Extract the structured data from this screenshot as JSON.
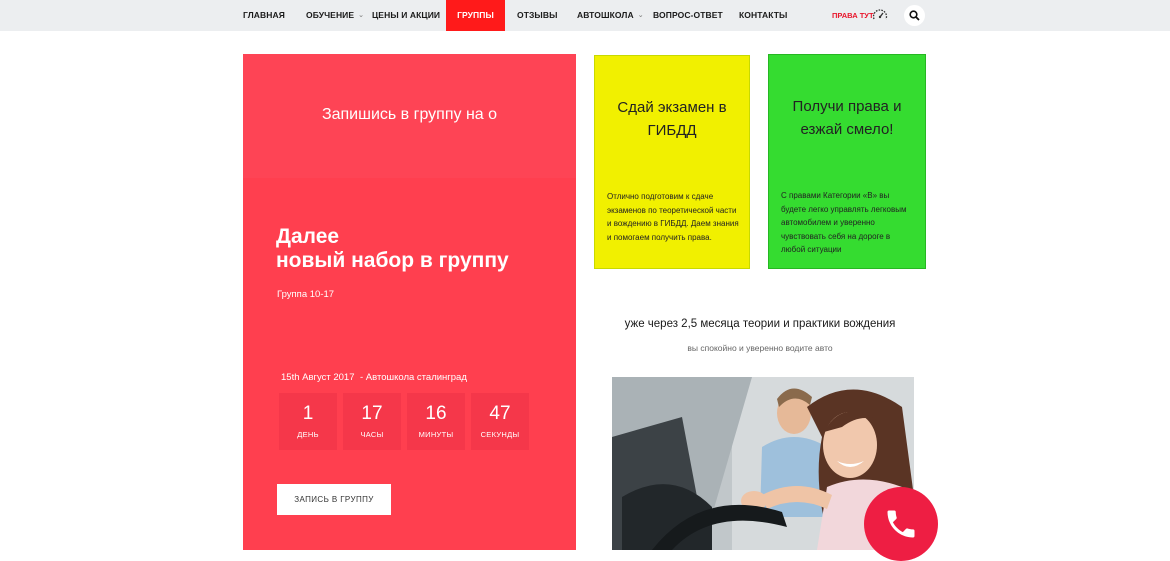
{
  "nav": {
    "items": [
      {
        "label": "ГЛАВНАЯ",
        "dropdown": false,
        "active": false
      },
      {
        "label": "ОБУЧЕНИЕ",
        "dropdown": true,
        "active": false
      },
      {
        "label": "ЦЕНЫ И АКЦИИ",
        "dropdown": false,
        "active": false
      },
      {
        "label": "ГРУППЫ",
        "dropdown": false,
        "active": true
      },
      {
        "label": "ОТЗЫВЫ",
        "dropdown": false,
        "active": false
      },
      {
        "label": "АВТОШКОЛА",
        "dropdown": true,
        "active": false
      },
      {
        "label": "ВОПРОС-ОТВЕТ",
        "dropdown": false,
        "active": false
      },
      {
        "label": "КОНТАКТЫ",
        "dropdown": false,
        "active": false
      }
    ],
    "rights_link": "ПРАВА ТУТ",
    "gauge_icon": "speedometer-icon",
    "search_icon": "search-icon"
  },
  "hero": {
    "title": "Запишись в группу на о",
    "heading_line1": "Далее",
    "heading_line2": "новый набор в группу",
    "group": "Группа 10-17",
    "date": "15th Август 2017",
    "place": "- Автошкола сталинград",
    "countdown": [
      {
        "value": "1",
        "label": "ДЕНЬ"
      },
      {
        "value": "17",
        "label": "ЧАСЫ"
      },
      {
        "value": "16",
        "label": "МИНУТЫ"
      },
      {
        "value": "47",
        "label": "СЕКУНДЫ"
      }
    ],
    "button_label": "ЗАПИСЬ В ГРУППУ"
  },
  "cards": [
    {
      "title_line1": "Сдай экзамен в",
      "title_line2": "ГИБДД",
      "text": "Отлично подготовим к сдаче экзаменов по теоретической части и вождению в ГИБДД. Даем знания и помогаем получить права.",
      "color": "#f1f000"
    },
    {
      "title_line1": "Получи права и",
      "title_line2": "езжай смело!",
      "text": "С правами Категории «В» вы будете легко управлять легковым автомобилем и уверенно чувствовать себя на дороге в любой ситуации",
      "color": "#35dc30"
    }
  ],
  "promo": {
    "main": "уже через 2,5 месяца теории и практики вождения",
    "sub": "вы спокойно и уверенно водите авто"
  },
  "colors": {
    "accent_red": "#ff3f4f",
    "nav_active": "#ff1a1a",
    "call_button": "#ee1e43"
  },
  "icons": {
    "call": "phone-icon"
  }
}
